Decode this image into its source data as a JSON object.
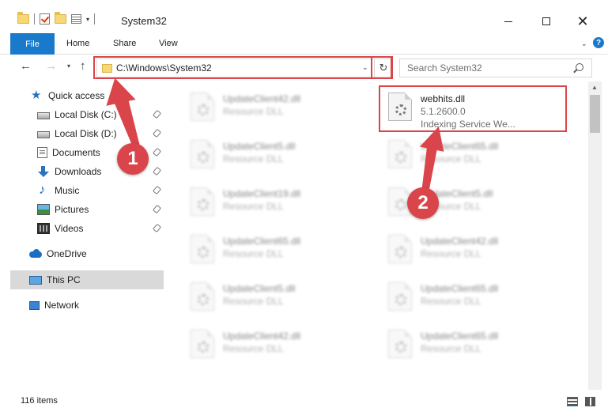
{
  "window": {
    "title": "System32",
    "minimize_glyph": "",
    "close_glyph": "✕"
  },
  "qat": {
    "dropdown_glyph": "▾"
  },
  "ribbon": {
    "tabs": [
      {
        "label": "File"
      },
      {
        "label": "Home"
      },
      {
        "label": "Share"
      },
      {
        "label": "View"
      }
    ],
    "help_glyph": "?",
    "collapse_glyph": "⌄"
  },
  "navigation": {
    "back_glyph": "←",
    "forward_glyph": "→",
    "recent_glyph": "▾",
    "up_glyph": "↑"
  },
  "address_bar": {
    "path": "C:\\Windows\\System32",
    "dropdown_glyph": "⌄",
    "refresh_glyph": "↻"
  },
  "search": {
    "placeholder": "Search System32"
  },
  "sidebar": {
    "items": [
      {
        "label": "Quick access",
        "icon": "star-icon"
      },
      {
        "label": "Local Disk (C:)",
        "icon": "drive-icon",
        "pinned": true
      },
      {
        "label": "Local Disk (D:)",
        "icon": "drive-icon",
        "pinned": true
      },
      {
        "label": "Documents",
        "icon": "documents-icon",
        "pinned": true
      },
      {
        "label": "Downloads",
        "icon": "downloads-icon",
        "pinned": true
      },
      {
        "label": "Music",
        "icon": "music-icon",
        "pinned": true
      },
      {
        "label": "Pictures",
        "icon": "pictures-icon",
        "pinned": true
      },
      {
        "label": "Videos",
        "icon": "videos-icon",
        "pinned": true
      },
      {
        "label": "OneDrive",
        "icon": "cloud-icon"
      },
      {
        "label": "This PC",
        "icon": "pc-icon",
        "selected": true
      },
      {
        "label": "Network",
        "icon": "network-icon"
      }
    ]
  },
  "files": {
    "highlighted": {
      "name": "webhits.dll",
      "version": "5.1.2600.0",
      "description": "Indexing Service We..."
    },
    "left_column": [
      {
        "name": "UpdateClient42.dll",
        "type": "Resource DLL"
      },
      {
        "name": "UpdateClient5.dll",
        "type": "Resource DLL"
      },
      {
        "name": "UpdateClient19.dll",
        "type": "Resource DLL"
      },
      {
        "name": "UpdateClient65.dll",
        "type": "Resource DLL"
      },
      {
        "name": "UpdateClient5.dll",
        "type": "Resource DLL"
      },
      {
        "name": "UpdateClient42.dll",
        "type": "Resource DLL"
      }
    ],
    "right_column": [
      {
        "name": "UpdateClient65.dll",
        "type": "Resource DLL"
      },
      {
        "name": "UpdateClient5.dll",
        "type": "Resource DLL"
      },
      {
        "name": "UpdateClient42.dll",
        "type": "Resource DLL"
      },
      {
        "name": "UpdateClient65.dll",
        "type": "Resource DLL"
      },
      {
        "name": "UpdateClient65.dll",
        "type": "Resource DLL"
      }
    ]
  },
  "scrollbar": {
    "up_glyph": "▲"
  },
  "status": {
    "item_count": "116 items"
  },
  "annotations": {
    "marker_1": "1",
    "marker_2": "2",
    "color": "#d9454a"
  }
}
